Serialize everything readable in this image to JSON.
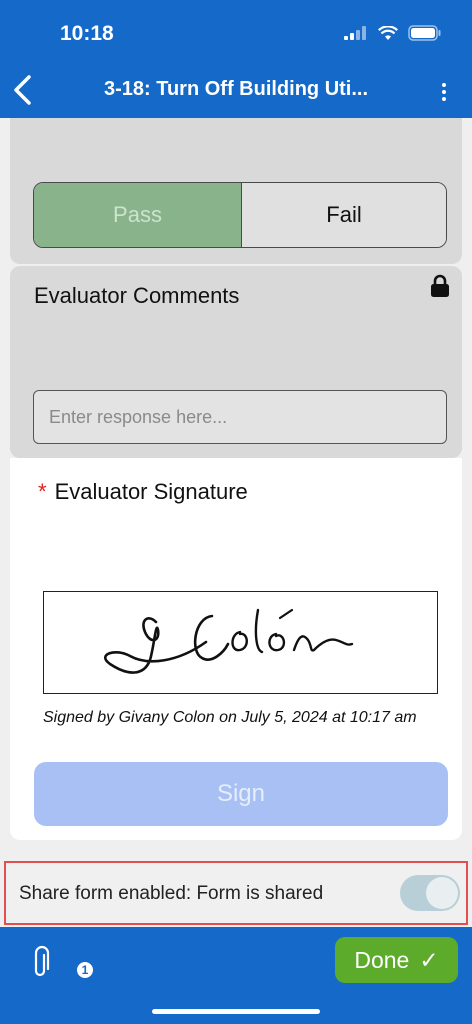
{
  "status_bar": {
    "time": "10:18"
  },
  "nav": {
    "title": "3-18: Turn Off Building Uti..."
  },
  "pass_fail": {
    "pass_label": "Pass",
    "fail_label": "Fail",
    "selected": "Pass"
  },
  "comments": {
    "title": "Evaluator Comments",
    "placeholder": "Enter response here..."
  },
  "signature": {
    "required_marker": "*",
    "title": "Evaluator Signature",
    "signed_by": "Signed by Givany Colon on July 5, 2024 at 10:17 am",
    "sign_label": "Sign",
    "handwriting": "G Colón"
  },
  "share": {
    "label": "Share form enabled: Form is shared",
    "enabled": true
  },
  "footer": {
    "attachment_count": "1",
    "done_label": "Done",
    "done_check": "✓"
  },
  "colors": {
    "brand": "#1469c9",
    "pass": "#88b38b",
    "done": "#5cab2a",
    "sign": "#a8c0f4"
  }
}
